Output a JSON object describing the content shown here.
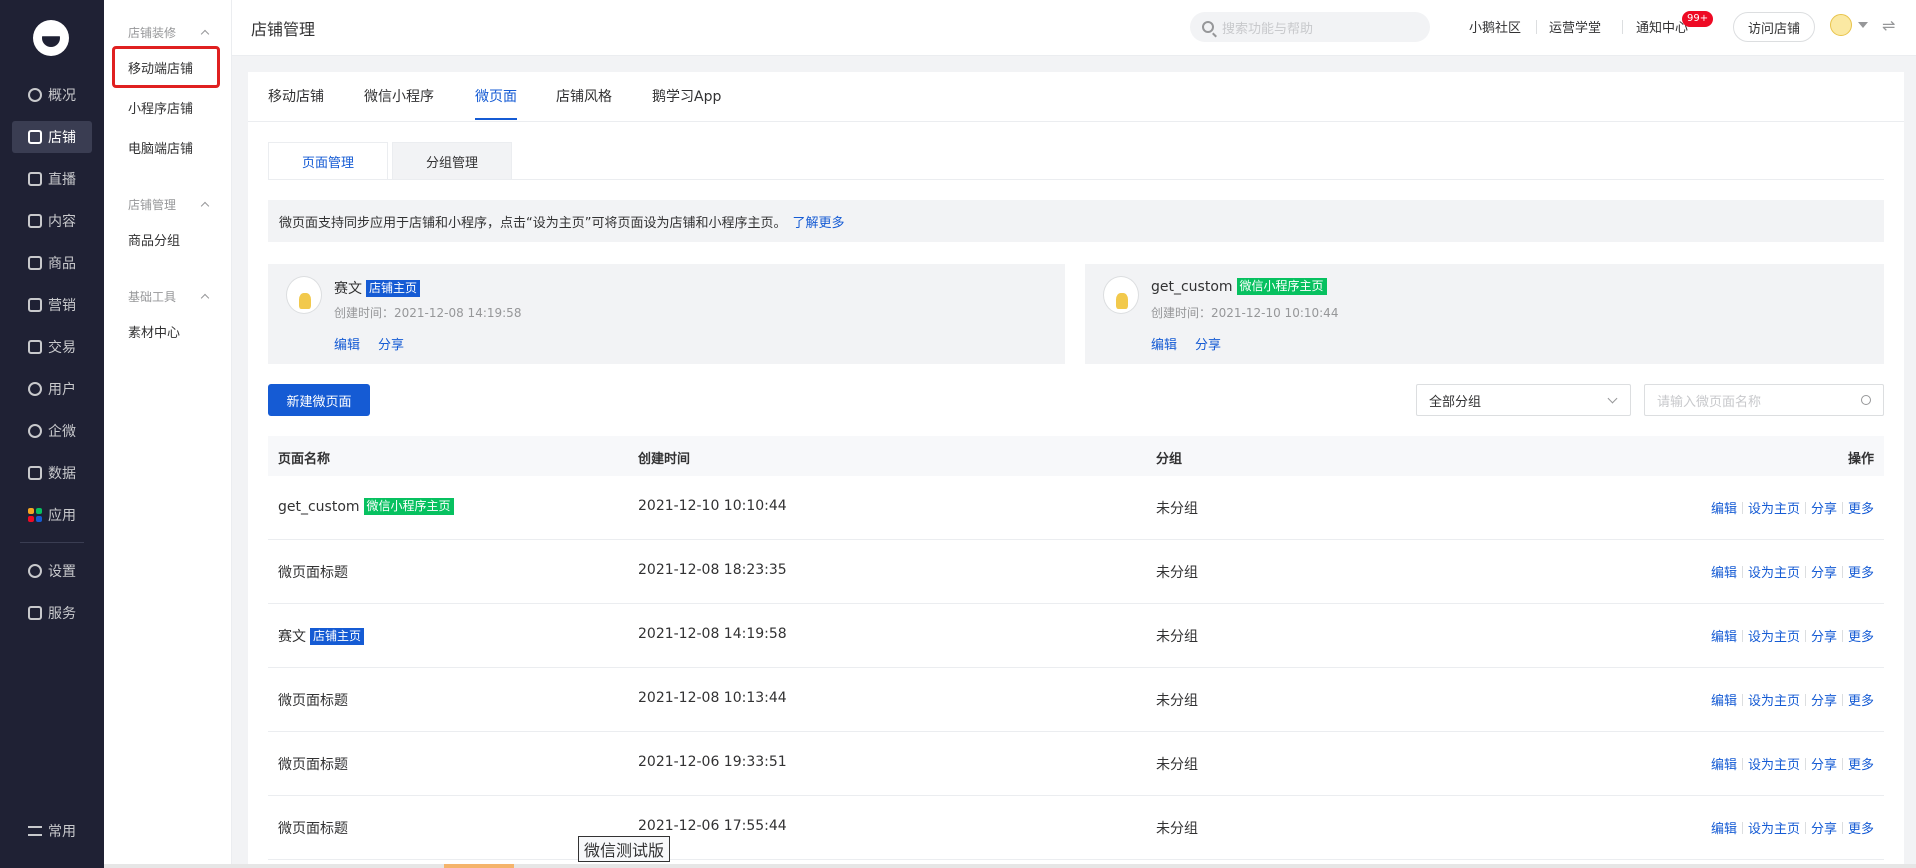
{
  "nav": {
    "items": [
      {
        "label": "概况",
        "icon": "pie-chart-icon"
      },
      {
        "label": "店铺",
        "icon": "shop-icon"
      },
      {
        "label": "直播",
        "icon": "live-icon"
      },
      {
        "label": "内容",
        "icon": "content-icon"
      },
      {
        "label": "商品",
        "icon": "goods-icon"
      },
      {
        "label": "营销",
        "icon": "marketing-icon"
      },
      {
        "label": "交易",
        "icon": "trade-icon"
      },
      {
        "label": "用户",
        "icon": "user-icon"
      },
      {
        "label": "企微",
        "icon": "wecom-icon"
      },
      {
        "label": "数据",
        "icon": "data-icon"
      },
      {
        "label": "应用",
        "icon": "apps-icon"
      },
      {
        "label": "设置",
        "icon": "settings-icon"
      },
      {
        "label": "服务",
        "icon": "service-icon"
      },
      {
        "label": "常用",
        "icon": "list-icon"
      }
    ]
  },
  "subnav": {
    "group1": "店铺装修",
    "group1_items": [
      "移动端店铺",
      "小程序店铺",
      "电脑端店铺"
    ],
    "group2": "店铺管理",
    "group2_items": [
      "商品分组"
    ],
    "group3": "基础工具",
    "group3_items": [
      "素材中心"
    ]
  },
  "header": {
    "title": "店铺管理",
    "search_placeholder": "搜索功能与帮助",
    "links": [
      "小鹅社区",
      "运营学堂",
      "通知中心"
    ],
    "badge": "99+",
    "visit_label": "访问店铺",
    "swap_icon": "⇌"
  },
  "tabs": [
    "移动店铺",
    "微信小程序",
    "微页面",
    "店铺风格",
    "鹅学习App"
  ],
  "subtabs": [
    "页面管理",
    "分组管理"
  ],
  "notice": {
    "text": "微页面支持同步应用于店铺和小程序，点击“设为主页”可将页面设为店铺和小程序主页。",
    "link": "了解更多"
  },
  "home_cards": [
    {
      "name": "赛文",
      "tag": "店铺主页",
      "time": "创建时间：2021-12-08 14:19:58",
      "edit": "编辑",
      "share": "分享"
    },
    {
      "name": "get_custom",
      "tag": "微信小程序主页",
      "time": "创建时间：2021-12-10 10:10:44",
      "edit": "编辑",
      "share": "分享"
    }
  ],
  "toolbar": {
    "new_label": "新建微页面",
    "group_value": "全部分组",
    "search_placeholder": "请输入微页面名称"
  },
  "table": {
    "headers": [
      "页面名称",
      "创建时间",
      "分组",
      "操作"
    ],
    "ops": [
      "编辑",
      "设为主页",
      "分享",
      "更多"
    ],
    "rows": [
      {
        "name": "get_custom",
        "tag": "微信小程序主页",
        "time": "2021-12-10 10:10:44",
        "group": "未分组"
      },
      {
        "name": "微页面标题",
        "tag": "",
        "time": "2021-12-08 18:23:35",
        "group": "未分组"
      },
      {
        "name": "赛文",
        "tag": "店铺主页",
        "time": "2021-12-08 14:19:58",
        "group": "未分组"
      },
      {
        "name": "微页面标题",
        "tag": "",
        "time": "2021-12-08 10:13:44",
        "group": "未分组"
      },
      {
        "name": "微页面标题",
        "tag": "",
        "time": "2021-12-06 19:33:51",
        "group": "未分组"
      },
      {
        "name": "微页面标题",
        "tag": "",
        "time": "2021-12-06 17:55:44",
        "group": "未分组"
      }
    ]
  },
  "tooltip": "微信测试版",
  "colors": {
    "primary": "#155bd4",
    "sidebar": "#1f2134",
    "green_tag": "#07c160",
    "badge": "#ee0a24"
  }
}
